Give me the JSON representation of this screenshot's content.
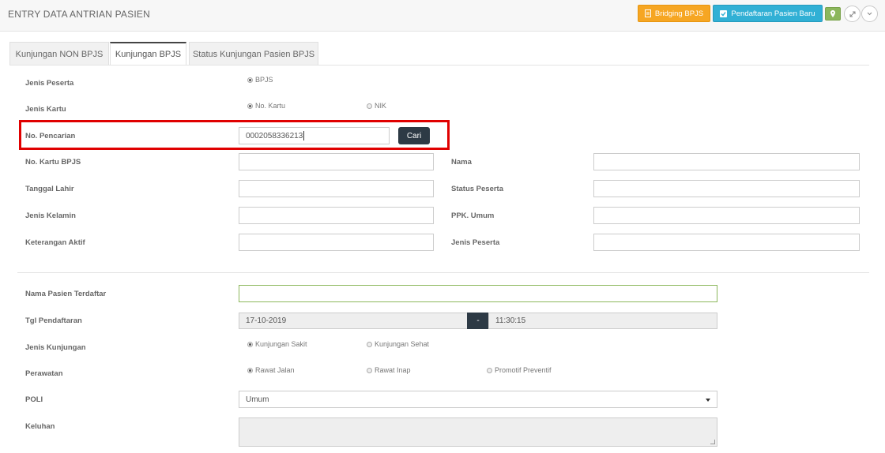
{
  "header": {
    "title": "ENTRY DATA ANTRIAN PASIEN",
    "bridging_label": "Bridging BPJS",
    "pendaftaran_label": "Pendaftaran Pasien Baru"
  },
  "tabs": [
    {
      "label": "Kunjungan NON BPJS"
    },
    {
      "label": "Kunjungan BPJS"
    },
    {
      "label": "Status Kunjungan Pasien BPJS"
    }
  ],
  "form": {
    "jenis_peserta_label": "Jenis Peserta",
    "jenis_peserta_option": "BPJS",
    "jenis_kartu_label": "Jenis Kartu",
    "kartu_opt1": "No. Kartu",
    "kartu_opt2": "NIK",
    "pencarian_label": "No. Pencarian",
    "pencarian_value": "0002058336213",
    "cari_label": "Cari",
    "no_kartu_label": "No. Kartu BPJS",
    "tgl_lahir_label": "Tanggal Lahir",
    "jenis_kelamin_label": "Jenis Kelamin",
    "ket_aktif_label": "Keterangan Aktif",
    "nama_label": "Nama",
    "status_peserta_label": "Status Peserta",
    "ppk_label": "PPK. Umum",
    "jenis_peserta2_label": "Jenis Peserta"
  },
  "form2": {
    "nama_pasien_label": "Nama Pasien Terdaftar",
    "tgl_pendaftaran_label": "Tgl Pendaftaran",
    "tgl_value": "17-10-2019",
    "dash": "-",
    "time_value": "11:30:15",
    "jenis_kunjungan_label": "Jenis Kunjungan",
    "kunjungan_opt1": "Kunjungan Sakit",
    "kunjungan_opt2": "Kunjungan Sehat",
    "perawatan_label": "Perawatan",
    "perawatan_opt1": "Rawat Jalan",
    "perawatan_opt2": "Rawat Inap",
    "perawatan_opt3": "Promotif Preventif",
    "poli_label": "POLI",
    "poli_value": "Umum",
    "keluhan_label": "Keluhan"
  },
  "colors": {
    "orange": "#f6a623",
    "blue": "#31b0d5",
    "green": "#8cb75c",
    "highlight": "#e00000",
    "dark_button": "#2d3a45"
  }
}
